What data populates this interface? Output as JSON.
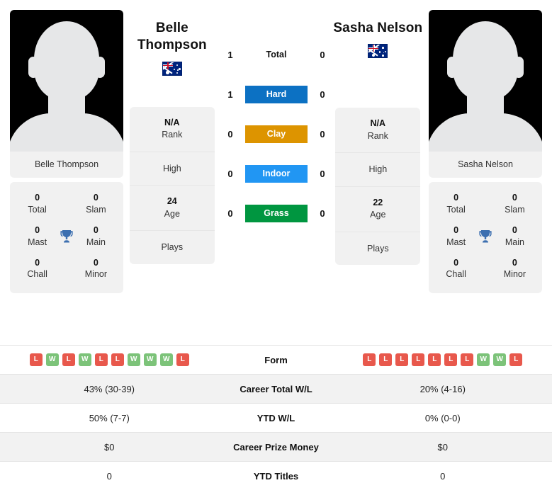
{
  "players": {
    "left": {
      "name": "Belle Thompson",
      "name_line1": "Belle",
      "name_line2": "Thompson",
      "country": "Australia",
      "flag_icon": "flag-australia",
      "photo_caption": "Belle Thompson",
      "titles": {
        "total_value": "0",
        "total_label": "Total",
        "slam_value": "0",
        "slam_label": "Slam",
        "mast_value": "0",
        "mast_label": "Mast",
        "main_value": "0",
        "main_label": "Main",
        "chall_value": "0",
        "chall_label": "Chall",
        "minor_value": "0",
        "minor_label": "Minor"
      },
      "info": {
        "rank_value": "N/A",
        "rank_label": "Rank",
        "high_value": "",
        "high_label": "High",
        "age_value": "24",
        "age_label": "Age",
        "plays_value": "",
        "plays_label": "Plays"
      }
    },
    "right": {
      "name": "Sasha Nelson",
      "name_line1": "Sasha Nelson",
      "name_line2": "",
      "country": "Australia",
      "flag_icon": "flag-australia",
      "photo_caption": "Sasha Nelson",
      "titles": {
        "total_value": "0",
        "total_label": "Total",
        "slam_value": "0",
        "slam_label": "Slam",
        "mast_value": "0",
        "mast_label": "Mast",
        "main_value": "0",
        "main_label": "Main",
        "chall_value": "0",
        "chall_label": "Chall",
        "minor_value": "0",
        "minor_label": "Minor"
      },
      "info": {
        "rank_value": "N/A",
        "rank_label": "Rank",
        "high_value": "",
        "high_label": "High",
        "age_value": "22",
        "age_label": "Age",
        "plays_value": "",
        "plays_label": "Plays"
      }
    }
  },
  "head_to_head": {
    "rows": [
      {
        "label": "Total",
        "left": "1",
        "right": "0",
        "color": "",
        "plain": true
      },
      {
        "label": "Hard",
        "left": "1",
        "right": "0",
        "color": "#0C71C3",
        "plain": false
      },
      {
        "label": "Clay",
        "left": "0",
        "right": "0",
        "color": "#DD9400",
        "plain": false
      },
      {
        "label": "Indoor",
        "left": "0",
        "right": "0",
        "color": "#2196F3",
        "plain": false
      },
      {
        "label": "Grass",
        "left": "0",
        "right": "0",
        "color": "#009640",
        "plain": false
      }
    ]
  },
  "comparison": {
    "form_row": {
      "label": "Form",
      "left_form": [
        "L",
        "W",
        "L",
        "W",
        "L",
        "L",
        "W",
        "W",
        "W",
        "L"
      ],
      "right_form": [
        "L",
        "L",
        "L",
        "L",
        "L",
        "L",
        "L",
        "W",
        "W",
        "L"
      ]
    },
    "rows": [
      {
        "label": "Career Total W/L",
        "left": "43% (30-39)",
        "right": "20% (4-16)"
      },
      {
        "label": "YTD W/L",
        "left": "50% (7-7)",
        "right": "0% (0-0)"
      },
      {
        "label": "Career Prize Money",
        "left": "$0",
        "right": "$0"
      },
      {
        "label": "YTD Titles",
        "left": "0",
        "right": "0"
      }
    ]
  },
  "colors": {
    "win": "#7CC379",
    "loss": "#E8584C",
    "trophy": "#3C6FB0",
    "card_bg": "#f1f1f1",
    "row_alt": "#f2f2f2"
  },
  "icons": {
    "trophy": "trophy-icon",
    "flag": "flag-icon"
  }
}
